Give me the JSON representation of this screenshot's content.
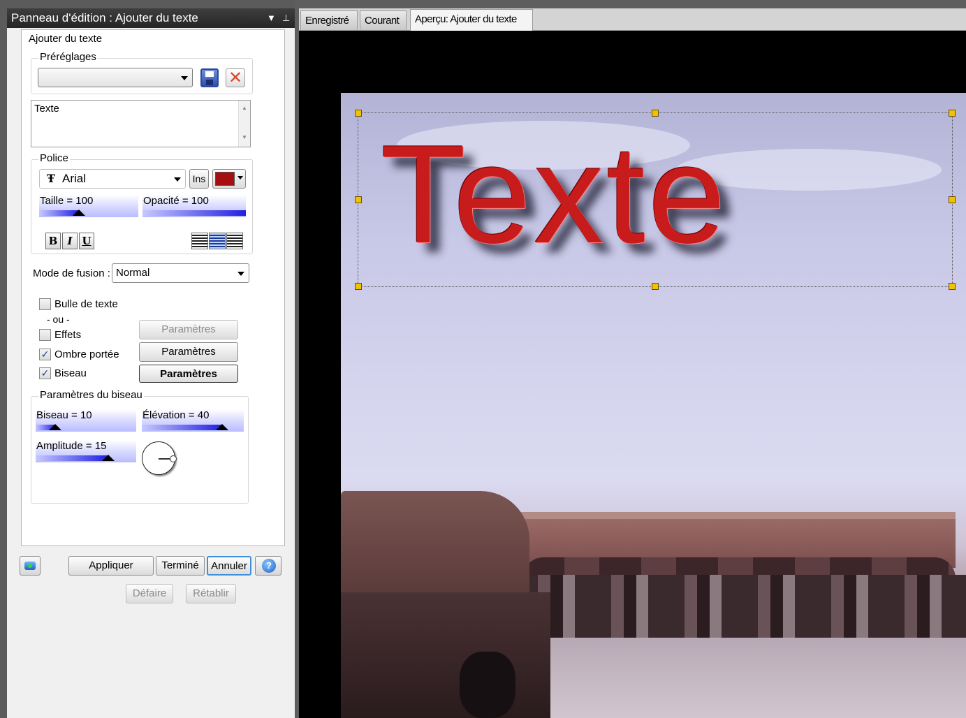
{
  "panel": {
    "title": "Panneau d'édition : Ajouter du texte",
    "tab_label": "Ajouter du texte",
    "presets": {
      "group_label": "Préréglages",
      "selected": ""
    },
    "text_field": {
      "value": "Texte"
    },
    "font": {
      "group_label": "Police",
      "family": "Arial",
      "ins_label": "Ins",
      "color": "#a50f0f",
      "size_label": "Taille = 100",
      "size_value": 100,
      "opacity_label": "Opacité = 100",
      "opacity_value": 100,
      "bold_label": "B",
      "italic_label": "I",
      "underline_label": "U",
      "alignment": "center"
    },
    "blend_mode": {
      "label": "Mode de fusion :",
      "value": "Normal"
    },
    "options": {
      "bubble": {
        "label": "Bulle de texte",
        "checked": false
      },
      "or_label": "- ou -",
      "effects": {
        "label": "Effets",
        "checked": false,
        "button": "Paramètres"
      },
      "drop_shadow": {
        "label": "Ombre portée",
        "checked": true,
        "button": "Paramètres"
      },
      "bevel": {
        "label": "Biseau",
        "checked": true,
        "button": "Paramètres"
      }
    },
    "bevel_params": {
      "group_label": "Paramètres du biseau",
      "bevel_label": "Biseau = 10",
      "bevel_value": 10,
      "elevation_label": "Élévation = 40",
      "elevation_value": 40,
      "amplitude_label": "Amplitude = 15",
      "amplitude_value": 15
    },
    "buttons": {
      "apply": "Appliquer",
      "done": "Terminé",
      "cancel": "Annuler",
      "undo": "Défaire",
      "redo": "Rétablir"
    }
  },
  "preview": {
    "tabs": [
      "Enregistré",
      "Courant",
      "Aperçu: Ajouter du texte"
    ],
    "active_tab": 2,
    "overlay_text": "Texte",
    "overlay_color": "#c81b1b"
  }
}
